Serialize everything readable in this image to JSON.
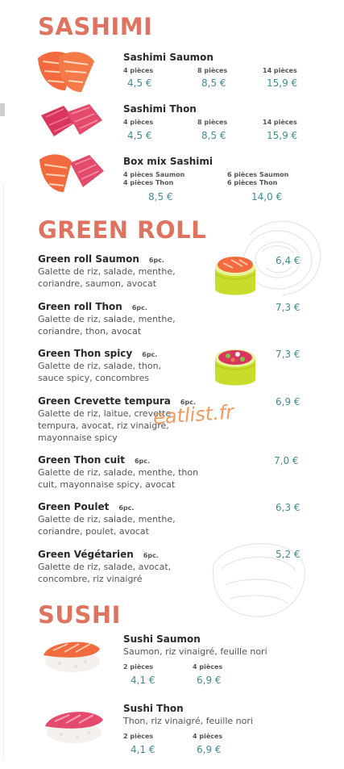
{
  "sections": {
    "sashimi": {
      "title": "SASHIMI",
      "items": [
        {
          "name": "Sashimi Saumon",
          "q1": "4 pièces",
          "p1": "4,5 €",
          "q2": "8 pièces",
          "p2": "8,5 €",
          "q3": "14 pièces",
          "p3": "15,9 €"
        },
        {
          "name": "Sashimi Thon",
          "q1": "4 pièces",
          "p1": "4,5 €",
          "q2": "8 pièces",
          "p2": "8,5 €",
          "q3": "14 pièces",
          "p3": "15,9 €"
        },
        {
          "name": "Box mix Sashimi",
          "q1a": "4 pièces Saumon",
          "q1b": "4 pièces Thon",
          "p1": "8,5 €",
          "q2a": "6 pièces Saumon",
          "q2b": "6 pièces Thon",
          "p2": "14,0 €"
        }
      ]
    },
    "green_roll": {
      "title": "GREEN ROLL",
      "items": [
        {
          "name": "Green roll Saumon",
          "pcs": "6pc.",
          "desc1": "Galette de riz, salade, menthe,",
          "desc2": "coriandre, saumon, avocat",
          "price": "6,4 €"
        },
        {
          "name": "Green roll Thon",
          "pcs": "6pc.",
          "desc1": "Galette de riz, salade, menthe,",
          "desc2": "coriandre, thon, avocat",
          "price": "7,3 €"
        },
        {
          "name": "Green Thon spicy",
          "pcs": "6pc.",
          "desc1": "Galette de riz, salade, thon,",
          "desc2": "sauce spicy, concombres",
          "price": "7,3 €"
        },
        {
          "name": "Green Crevette tempura",
          "pcs": "6pc.",
          "desc1": "Galette de riz, laitue, crevette",
          "desc2": "tempura, avocat, riz vinaigré,",
          "desc3": "mayonnaise spicy",
          "price": "6,9 €"
        },
        {
          "name": "Green Thon cuit",
          "pcs": "6pc.",
          "desc1": "Galette de riz, salade, menthe, thon",
          "desc2": "cuit, mayonnaise spicy, avocat",
          "price": "7,0 €"
        },
        {
          "name": "Green Poulet",
          "pcs": "6pc.",
          "desc1": "Galette de riz, salade, menthe,",
          "desc2": "coriandre, poulet, avocat",
          "price": "6,3 €"
        },
        {
          "name": "Green Végétarien",
          "pcs": "6pc.",
          "desc1": "Galette de riz, salade, avocat,",
          "desc2": "concombre, riz vinaigré",
          "price": "5,2 €"
        }
      ]
    },
    "sushi": {
      "title": "SUSHI",
      "items": [
        {
          "name": "Sushi Saumon",
          "desc": "Saumon, riz vinaigré, feuille nori",
          "q1": "2 pièces",
          "p1": "4,1 €",
          "q2": "4 pièces",
          "p2": "6,9 €"
        },
        {
          "name": "Sushi Thon",
          "desc": "Thon, riz vinaigré, feuille nori",
          "q1": "2 pièces",
          "p1": "4,1 €",
          "q2": "4 pièces",
          "p2": "6,9 €"
        }
      ]
    }
  },
  "watermark": "eatlist.fr",
  "colors": {
    "title": "#e0735f",
    "price": "#3c8f95",
    "watermark": "#f08a45",
    "salmon": "#f26a3d",
    "tuna": "#e0456a",
    "roll_wrap": "#c8dc2a"
  }
}
